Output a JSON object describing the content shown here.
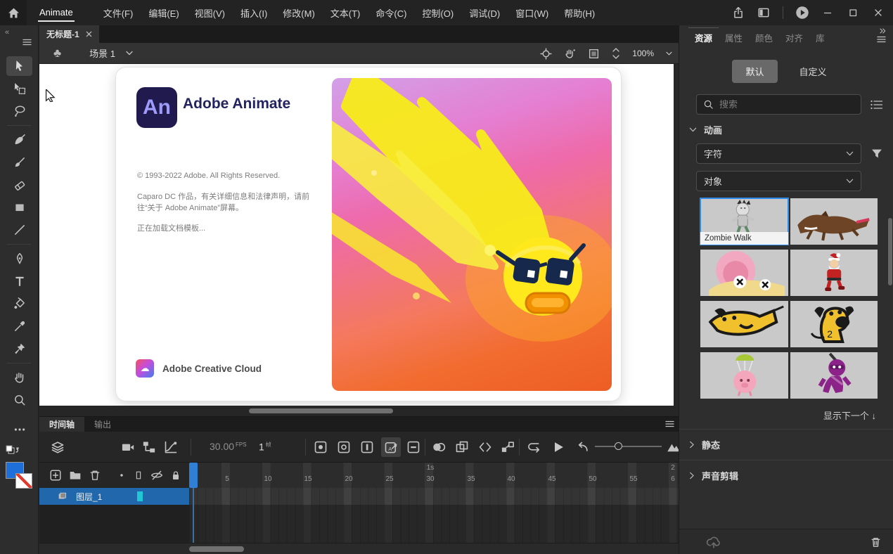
{
  "menubar": {
    "brand": "Animate",
    "items": [
      "文件(F)",
      "编辑(E)",
      "视图(V)",
      "插入(I)",
      "修改(M)",
      "文本(T)",
      "命令(C)",
      "控制(O)",
      "调试(D)",
      "窗口(W)",
      "帮助(H)"
    ]
  },
  "document": {
    "tab_title": "无标题-1"
  },
  "edit_bar": {
    "scene": "场景 1",
    "zoom": "100%"
  },
  "splash": {
    "logo": "An",
    "title": "Adobe Animate",
    "copyright": "© 1993-2022 Adobe. All Rights Reserved.",
    "notice": "Caparo DC 作品，有关详细信息和法律声明，请前往“关于 Adobe Animate”屏幕。",
    "loading": "正在加载文档模板...",
    "cc_label": "Adobe Creative Cloud"
  },
  "assets_panel": {
    "tabs": [
      "资源",
      "属性",
      "颜色",
      "对齐",
      "库"
    ],
    "modes": [
      "默认",
      "自定义"
    ],
    "search_placeholder": "搜索",
    "section_animated": "动画",
    "dropdown_category": "字符",
    "dropdown_type": "对象",
    "selected_asset_label": "Zombie Walk",
    "asset_kinds": [
      "zombie-walk",
      "wolf-run",
      "snail",
      "santa-walk",
      "dog-run",
      "dog-sit",
      "pig-parachute",
      "ninja"
    ],
    "show_next": "显示下一个 ↓",
    "section_static": "静态",
    "section_sound": "声音剪辑"
  },
  "timeline": {
    "tabs": [
      "时间轴",
      "输出"
    ],
    "fps": "30.00",
    "fps_unit": "FPS",
    "frame": "1",
    "frame_unit": "帧",
    "seconds_marks": [
      "1s",
      "2"
    ],
    "frame_marks": [
      "5",
      "10",
      "15",
      "20",
      "25",
      "30",
      "35",
      "40",
      "45",
      "50",
      "55",
      "6"
    ],
    "layer_name": "图层_1"
  },
  "colors": {
    "accent_blue": "#2d8ceb",
    "layer_selected": "#2068ab",
    "fill_swatch": "#1e6fd9",
    "outline_chip": "#22c7d6"
  }
}
